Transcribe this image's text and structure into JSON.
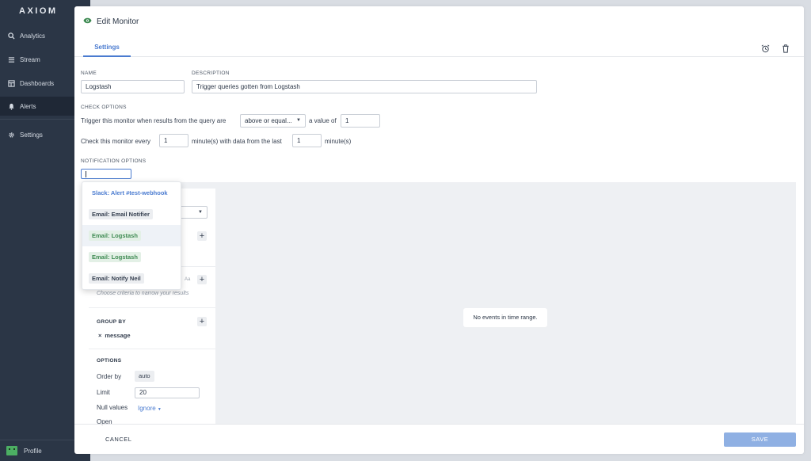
{
  "sidebar": {
    "logo": "AXIOM",
    "items": [
      {
        "label": "Analytics",
        "icon": "search-icon"
      },
      {
        "label": "Stream",
        "icon": "stream-icon"
      },
      {
        "label": "Dashboards",
        "icon": "dashboard-icon"
      },
      {
        "label": "Alerts",
        "icon": "bell-icon"
      },
      {
        "label": "Settings",
        "icon": "gear-icon"
      }
    ],
    "profile": "Profile"
  },
  "modal": {
    "title": "Edit Monitor",
    "tab": "Settings",
    "name_label": "NAME",
    "name_value": "Logstash",
    "description_label": "DESCRIPTION",
    "description_value": "Trigger queries gotten from Logstash",
    "check_options_label": "CHECK OPTIONS",
    "trigger_text": "Trigger this monitor when results from the query are",
    "operator_value": "above or equal...",
    "value_text": "a value of",
    "value_input": "1",
    "check_every_text": "Check this monitor every",
    "every_input": "1",
    "minutes_data_text": "minute(s) with data from the last",
    "last_input": "1",
    "minutes_text": "minute(s)",
    "notification_label": "NOTIFICATION OPTIONS"
  },
  "dropdown": {
    "items": [
      {
        "label": "Slack: Alert #test-webhook",
        "color": "#4a7bd0",
        "bg": "#ffffff"
      },
      {
        "label": "Email: Email Notifier",
        "color": "#374151",
        "bg": "#eceef1"
      },
      {
        "label": "Email: Logstash",
        "color": "#3e8a52",
        "bg": "#e3f0e6"
      },
      {
        "label": "Email: Logstash",
        "color": "#3e8a52",
        "bg": "#e3f0e6"
      },
      {
        "label": "Email: Notify Neil",
        "color": "#374151",
        "bg": "#eceef1"
      }
    ]
  },
  "query": {
    "filter_hint": "Choose criteria to narrow your results",
    "case_toggle": "Aa",
    "group_by_label": "GROUP BY",
    "group_by_value": "message",
    "options_label": "OPTIONS",
    "order_by_label": "Order by",
    "order_by_value": "auto",
    "limit_label": "Limit",
    "limit_value": "20",
    "null_values_label": "Null values",
    "null_values_value": "Ignore",
    "open_label": "Open",
    "no_events": "No events in time range."
  },
  "footer": {
    "cancel": "CANCEL",
    "save": "SAVE"
  },
  "colors": {
    "accent": "#4a7bd0",
    "sidebar_bg": "#2b3646",
    "save_bg": "#8fb0e3"
  }
}
